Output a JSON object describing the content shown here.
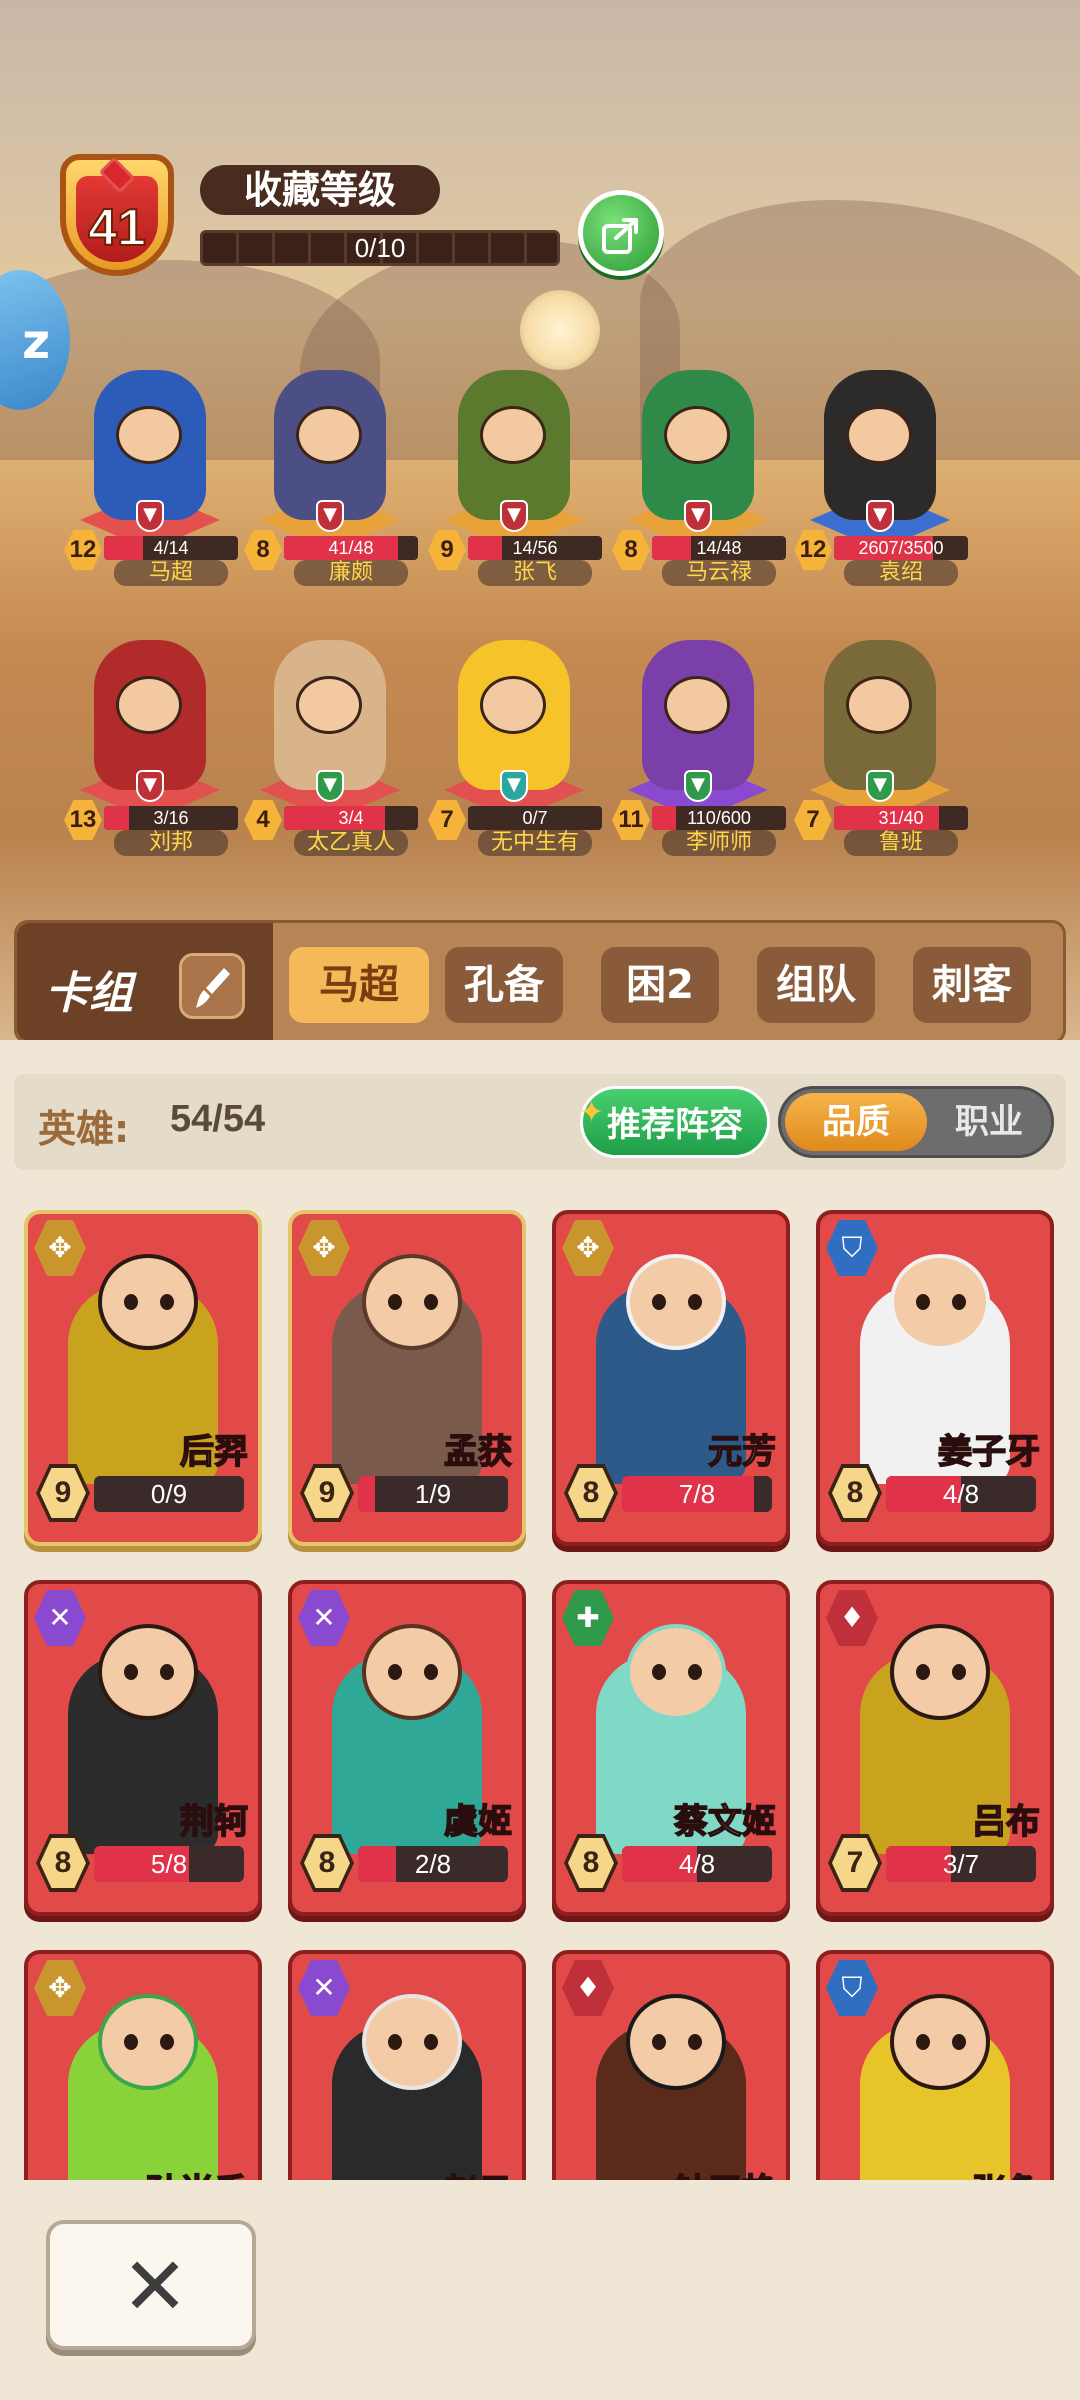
{
  "collection": {
    "level": "41",
    "title": "收藏等级",
    "progress_text": "0/10",
    "progress": 0
  },
  "featured_heroes": [
    {
      "name": "马超",
      "level": "12",
      "progress_text": "4/14",
      "progress": 0.29,
      "role_color": "#c0303a",
      "platform_color": "#e25050",
      "body_color": "#2c5bb8"
    },
    {
      "name": "廉颇",
      "level": "8",
      "progress_text": "41/48",
      "progress": 0.85,
      "role_color": "#c0303a",
      "platform_color": "#e8a23a",
      "body_color": "#4b4f86"
    },
    {
      "name": "张飞",
      "level": "9",
      "progress_text": "14/56",
      "progress": 0.25,
      "role_color": "#c0303a",
      "platform_color": "#e8a23a",
      "body_color": "#5b7a2e"
    },
    {
      "name": "马云禄",
      "level": "8",
      "progress_text": "14/48",
      "progress": 0.29,
      "role_color": "#c0303a",
      "platform_color": "#e8a23a",
      "body_color": "#2f8a4a"
    },
    {
      "name": "袁绍",
      "level": "12",
      "progress_text": "2607/3500",
      "progress": 0.74,
      "role_color": "#c0303a",
      "platform_color": "#3a6fd0",
      "body_color": "#2d2a2a"
    },
    {
      "name": "刘邦",
      "level": "13",
      "progress_text": "3/16",
      "progress": 0.19,
      "role_color": "#c0303a",
      "platform_color": "#e25050",
      "body_color": "#b22b2b"
    },
    {
      "name": "太乙真人",
      "level": "4",
      "progress_text": "3/4",
      "progress": 0.75,
      "role_color": "#2f9a4a",
      "platform_color": "#e25050",
      "body_color": "#d9b38a"
    },
    {
      "name": "无中生有",
      "level": "7",
      "progress_text": "0/7",
      "progress": 0,
      "role_color": "#2aa8a0",
      "platform_color": "#e25050",
      "body_color": "#f6c42a"
    },
    {
      "name": "李师师",
      "level": "11",
      "progress_text": "110/600",
      "progress": 0.18,
      "role_color": "#2f9a4a",
      "platform_color": "#8a4ad0",
      "body_color": "#7a3fa8"
    },
    {
      "name": "鲁班",
      "level": "7",
      "progress_text": "31/40",
      "progress": 0.78,
      "role_color": "#2f9a4a",
      "platform_color": "#e8a23a",
      "body_color": "#7a6a3a"
    }
  ],
  "deck": {
    "label": "卡组",
    "tabs": [
      "马超",
      "孔备",
      "困2",
      "组队",
      "刺客"
    ],
    "active_tab": 0
  },
  "heroes_summary": {
    "label": "英雄:",
    "count": "54/54",
    "recommend_button": "推荐阵容",
    "sort_options": [
      "品质",
      "职业"
    ],
    "sort_selected": 0
  },
  "cards": [
    {
      "name": "后羿",
      "level": "9",
      "progress_text": "0/9",
      "progress": 0,
      "class_icon": "crossbow-icon",
      "class_color": "#c9962e",
      "gold": true,
      "body_color": "#c9a21e",
      "head_color": "#2c1a12"
    },
    {
      "name": "孟获",
      "level": "9",
      "progress_text": "1/9",
      "progress": 0.11,
      "class_icon": "crossbow-icon",
      "class_color": "#c9962e",
      "gold": true,
      "body_color": "#7a5a4a",
      "head_color": "#5a3a2a"
    },
    {
      "name": "元芳",
      "level": "8",
      "progress_text": "7/8",
      "progress": 0.875,
      "class_icon": "crossbow-icon",
      "class_color": "#c9962e",
      "gold": false,
      "body_color": "#2e5a8a",
      "head_color": "#f1f1f1"
    },
    {
      "name": "姜子牙",
      "level": "8",
      "progress_text": "4/8",
      "progress": 0.5,
      "class_icon": "helmet-icon",
      "class_color": "#2f6ec0",
      "gold": false,
      "body_color": "#f1f1f1",
      "head_color": "#f1f1f1"
    },
    {
      "name": "荆轲",
      "level": "8",
      "progress_text": "5/8",
      "progress": 0.625,
      "class_icon": "daggers-icon",
      "class_color": "#8a4ad0",
      "gold": false,
      "body_color": "#2c2c2c",
      "head_color": "#2c1a12"
    },
    {
      "name": "虞姬",
      "level": "8",
      "progress_text": "2/8",
      "progress": 0.25,
      "class_icon": "daggers-icon",
      "class_color": "#8a4ad0",
      "gold": false,
      "body_color": "#2fa898",
      "head_color": "#5a3320"
    },
    {
      "name": "蔡文姬",
      "level": "8",
      "progress_text": "4/8",
      "progress": 0.5,
      "class_icon": "plus-shield-icon",
      "class_color": "#2f9a4a",
      "gold": false,
      "body_color": "#7fd9c6",
      "head_color": "#7fd9c6"
    },
    {
      "name": "吕布",
      "level": "7",
      "progress_text": "3/7",
      "progress": 0.43,
      "class_icon": "sword-shield-icon",
      "class_color": "#c0303a",
      "gold": false,
      "body_color": "#c9a21e",
      "head_color": "#2c1a12"
    },
    {
      "name": "孙尚香",
      "level": "",
      "progress_text": "",
      "progress": 0,
      "class_icon": "crossbow-icon",
      "class_color": "#c9962e",
      "gold": false,
      "body_color": "#8ad23a",
      "head_color": "#3aa84a"
    },
    {
      "name": "赵云",
      "level": "",
      "progress_text": "",
      "progress": 0,
      "class_icon": "daggers-icon",
      "class_color": "#8a4ad0",
      "gold": false,
      "body_color": "#2a2a2a",
      "head_color": "#e6e6e6"
    },
    {
      "name": "钟无艳",
      "level": "",
      "progress_text": "",
      "progress": 0,
      "class_icon": "sword-shield-icon",
      "class_color": "#c0303a",
      "gold": false,
      "body_color": "#5a2a1a",
      "head_color": "#1a1a1a"
    },
    {
      "name": "张角",
      "level": "",
      "progress_text": "",
      "progress": 0,
      "class_icon": "helmet-icon",
      "class_color": "#2f6ec0",
      "gold": false,
      "body_color": "#e6c42a",
      "head_color": "#2c1a12"
    }
  ],
  "close_button": "✕",
  "side_tab_glyph": "z",
  "colors": {
    "accent_orange": "#f6b95a",
    "card_red": "#e24a4a",
    "progress_red": "#e0334a",
    "green_button": "#2a9a33"
  }
}
